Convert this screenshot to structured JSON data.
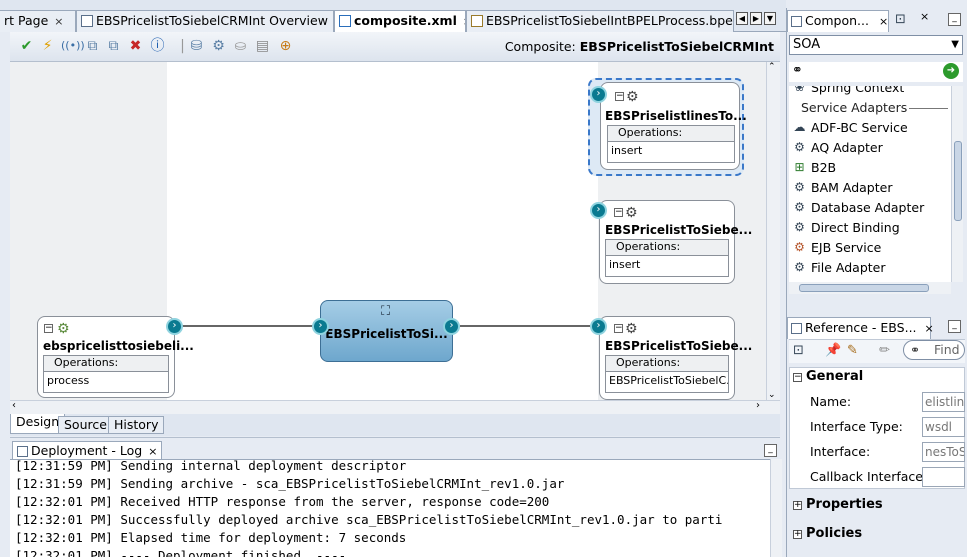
{
  "editor_tabs": [
    {
      "label": "rt Page",
      "active": false
    },
    {
      "label": "EBSPricelistToSiebelCRMInt Overview",
      "active": false
    },
    {
      "label": "composite.xml",
      "active": true
    },
    {
      "label": "EBSPricelistToSiebelIntBPELProcess.bpel",
      "active": false
    }
  ],
  "close_glyph": "×",
  "toolbar": {
    "composite_label": "Composite:",
    "composite_name": "EBSPricelistToSiebelCRMInt"
  },
  "components": {
    "service": {
      "title": "ebspricelisttosiebeli...",
      "operations_label": "Operations:",
      "operation": "process"
    },
    "bpel": {
      "title": "EBSPricelistToSi..."
    },
    "ref1": {
      "title": "EBSPriselistlinesTo...",
      "operations_label": "Operations:",
      "operation": "insert"
    },
    "ref2": {
      "title": "EBSPricelistToSiebe...",
      "operations_label": "Operations:",
      "operation": "insert"
    },
    "ref3": {
      "title": "EBSPricelistToSiebe...",
      "operations_label": "Operations:",
      "operation": "EBSPricelistToSiebelC..."
    }
  },
  "bottom_tabs": [
    "Design",
    "Source",
    "History"
  ],
  "log": {
    "tab_label": "Deployment - Log",
    "lines": [
      "[12:31:59 PM] Sending internal deployment descriptor",
      "[12:31:59 PM] Sending archive - sca_EBSPricelistToSiebelCRMInt_rev1.0.jar",
      "[12:32:01 PM] Received HTTP response from the server, response code=200",
      "[12:32:01 PM] Successfully deployed archive sca_EBSPricelistToSiebelCRMInt_rev1.0.jar to parti",
      "[12:32:01 PM] Elapsed time for deployment:  7 seconds",
      "[12:32:01 PM] ----  Deployment finished.  ----"
    ]
  },
  "palette": {
    "tab_label": "Compon...",
    "selected_category": "SOA",
    "partial_item": "Spring Context",
    "section_label": "Service Adapters",
    "items": [
      {
        "label": "ADF-BC Service",
        "icon": "adf-bc-icon"
      },
      {
        "label": "AQ Adapter",
        "icon": "aq-adapter-icon"
      },
      {
        "label": "B2B",
        "icon": "b2b-icon"
      },
      {
        "label": "BAM Adapter",
        "icon": "bam-adapter-icon"
      },
      {
        "label": "Database Adapter",
        "icon": "database-adapter-icon"
      },
      {
        "label": "Direct Binding",
        "icon": "direct-binding-icon"
      },
      {
        "label": "EJB Service",
        "icon": "ejb-service-icon"
      },
      {
        "label": "File Adapter",
        "icon": "file-adapter-icon"
      }
    ]
  },
  "reference": {
    "tab_label": "Reference - EBS...",
    "find_placeholder": "Find",
    "general_label": "General",
    "fields": [
      {
        "label": "Name:",
        "value": "elistline"
      },
      {
        "label": "Interface Type:",
        "value": "wsdl"
      },
      {
        "label": "Interface:",
        "value": "nesToS"
      },
      {
        "label": "Callback Interface:",
        "value": ""
      }
    ],
    "properties_label": "Properties",
    "policies_label": "Policies"
  }
}
